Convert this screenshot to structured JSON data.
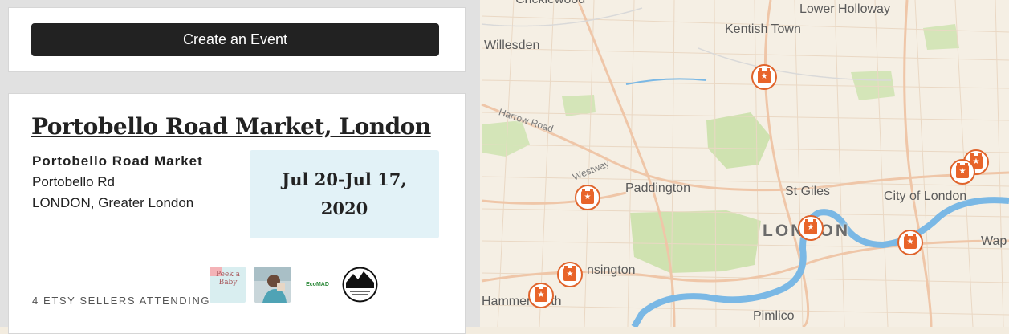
{
  "create_event": {
    "button_label": "Create an Event"
  },
  "event": {
    "title": "Portobello Road Market, London",
    "venue_name": "Portobello Road Market",
    "street": "Portobello Rd",
    "city": "LONDON, Greater London",
    "dates": "Jul 20-Jul 17, 2020",
    "sellers_attending": "4 ETSY SELLERS ATTENDING",
    "shops": [
      {
        "name": "shop-peek-a-baby",
        "logo_text": "Peek a Baby"
      },
      {
        "name": "shop-photo"
      },
      {
        "name": "shop-ecomad",
        "logo_text": "EcoMAD"
      },
      {
        "name": "shop-epic-nature",
        "logo_text": "EPIC NATURE"
      }
    ]
  },
  "map": {
    "labels": {
      "cricklewood": "Cricklewood",
      "lower_holloway": "Lower Holloway",
      "kentish_town": "Kentish Town",
      "willesden": "Willesden",
      "harrow_road": "Harrow Road",
      "westway": "Westway",
      "paddington": "Paddington",
      "st_giles": "St Giles",
      "city_of_london": "City of London",
      "london": "LONDON",
      "kensington": "nsington",
      "hammersmith": "Hammersmith",
      "pimlico": "Pimlico",
      "wap": "Wap"
    },
    "pin_icon": "etsy-event-calendar-icon",
    "colors": {
      "park": "#c9dfa9",
      "water": "#77b7e6",
      "pin": "#e8642a",
      "road": "#eac2a4"
    }
  }
}
